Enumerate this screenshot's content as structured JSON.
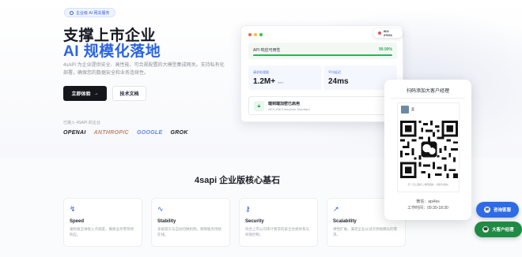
{
  "hero": {
    "badge": "企业级 AI 网关服务",
    "title_line1": "支撑上市企业",
    "title_line2": "AI 规模化落地",
    "description": "4sAPI 为企业提供安全、高性能、可合规配置的大模型集成网关。支持私有化部署，确保您的数据安全和业务连续性。",
    "primary_button": "立即体验",
    "secondary_button": "技术文档",
    "support_label": "已接入 4SAPI 的企业",
    "partners": [
      "OPENAI",
      "ANTHROPIC",
      "GOOGLE",
      "GROK"
    ]
  },
  "dashboard": {
    "iso_badge": "ISO 27001",
    "availability_label": "API 响应可用性",
    "availability_value": "99.99%",
    "availability_fraction": 0.9999,
    "stats": [
      {
        "label": "请求处理量",
        "value": "1.2M+",
        "unit": "/min"
      },
      {
        "label": "平均延迟",
        "value": "24ms",
        "unit": ""
      }
    ],
    "encryption_title": "端到端加密已启用",
    "encryption_sub": "AES-256 Enterprise Standard"
  },
  "section": {
    "title": "4sapi 企业版核心基石",
    "features": [
      {
        "icon": "↯",
        "name": "Speed",
        "text": "毫秒级全球接入点调度，确保业务零等待响应。"
      },
      {
        "icon": "∿",
        "name": "Stability",
        "text": "多级容灾与自动切换机制，保障服务持续在线。"
      },
      {
        "icon": "⚷",
        "name": "Security",
        "text": "符合上市公司审计要求的安全合规体系与权限控制。"
      },
      {
        "icon": "↗",
        "name": "Scalability",
        "text": "弹性扩展，满足企业从试点到规模化的需求。"
      }
    ]
  },
  "qr_popup": {
    "title": "扫码添加大客户经理",
    "contact_name": "菜",
    "scan_hint": "扫一扫上面的二维码图案，加我为朋友。",
    "contact_line1": "微信：api4ss",
    "contact_line2": "工作时间：09:30-18:30"
  },
  "floating": {
    "consult": "咨询客服",
    "enterprise": "大客户经理"
  },
  "colors": {
    "accent": "#2a63e5",
    "success": "#2bb35a",
    "consult_bg": "#2e6be6",
    "enterprise_bg": "#1f8a44"
  }
}
